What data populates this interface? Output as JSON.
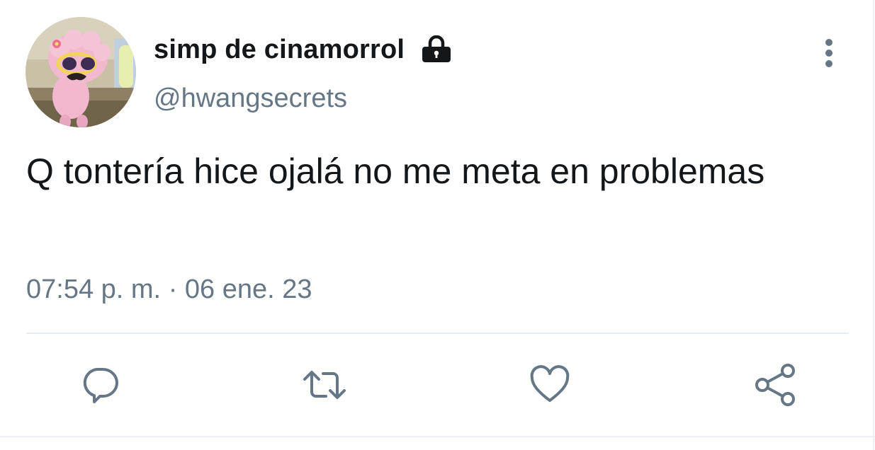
{
  "user": {
    "display_name": "simp de cinamorrol",
    "handle": "@hwangsecrets",
    "protected_icon": "lock-icon",
    "avatar_icon": "avatar-image"
  },
  "tweet": {
    "text": "Q tontería hice ojalá no me meta en problemas",
    "time": "07:54 p. m.",
    "separator": "·",
    "date": "06 ene. 23"
  },
  "actions": {
    "reply_icon": "reply-icon",
    "retweet_icon": "retweet-icon",
    "like_icon": "heart-icon",
    "share_icon": "share-icon",
    "more_icon": "more-vertical-icon"
  },
  "colors": {
    "text_primary": "#14171a",
    "text_secondary": "#657786",
    "divider": "#e6ecf0",
    "icon": "#657786"
  }
}
